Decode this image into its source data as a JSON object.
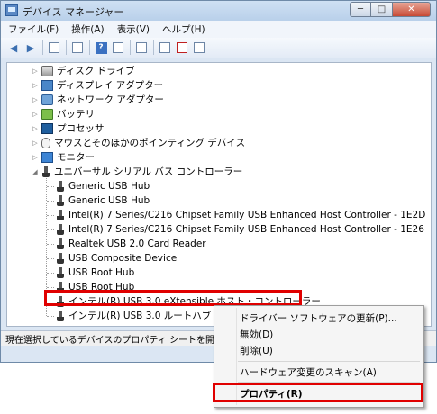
{
  "window": {
    "title": "デバイス マネージャー",
    "minimize_glyph": "─",
    "maximize_glyph": "□",
    "close_glyph": "✕"
  },
  "menu": [
    "ファイル(F)",
    "操作(A)",
    "表示(V)",
    "ヘルプ(H)"
  ],
  "toolbar": {
    "back": "◀",
    "forward": "▶",
    "help": "?"
  },
  "tree": {
    "categories": [
      {
        "label": "ディスク ドライブ",
        "icon": "disk-drive-icon"
      },
      {
        "label": "ディスプレイ アダプター",
        "icon": "display-adapter-icon"
      },
      {
        "label": "ネットワーク アダプター",
        "icon": "network-adapter-icon"
      },
      {
        "label": "バッテリ",
        "icon": "battery-icon"
      },
      {
        "label": "プロセッサ",
        "icon": "processor-icon"
      },
      {
        "label": "マウスとそのほかのポインティング デバイス",
        "icon": "mouse-icon"
      },
      {
        "label": "モニター",
        "icon": "monitor-icon"
      },
      {
        "label": "ユニバーサル シリアル バス コントローラー",
        "icon": "usb-icon"
      }
    ],
    "usb_devices": [
      "Generic USB Hub",
      "Generic USB Hub",
      "Intel(R) 7 Series/C216 Chipset Family USB Enhanced Host Controller - 1E2D",
      "Intel(R) 7 Series/C216 Chipset Family USB Enhanced Host Controller - 1E26",
      "Realtek USB 2.0 Card Reader",
      "USB Composite Device",
      "USB Root Hub",
      "USB Root Hub",
      "インテル(R) USB 3.0 eXtensible ホスト・コントローラー",
      "インテル(R) USB 3.0 ルートハブ"
    ],
    "collapsed_glyph": "▷",
    "expanded_glyph": "◢"
  },
  "status": {
    "text": "現在選択しているデバイスのプロパティ シートを開き"
  },
  "context_menu": {
    "update_driver": "ドライバー ソフトウェアの更新(P)...",
    "disable": "無効(D)",
    "uninstall": "削除(U)",
    "scan": "ハードウェア変更のスキャン(A)",
    "properties": "プロパティ(R)"
  },
  "colors": {
    "highlight": "#e00000",
    "accent": "#3b71c1"
  }
}
